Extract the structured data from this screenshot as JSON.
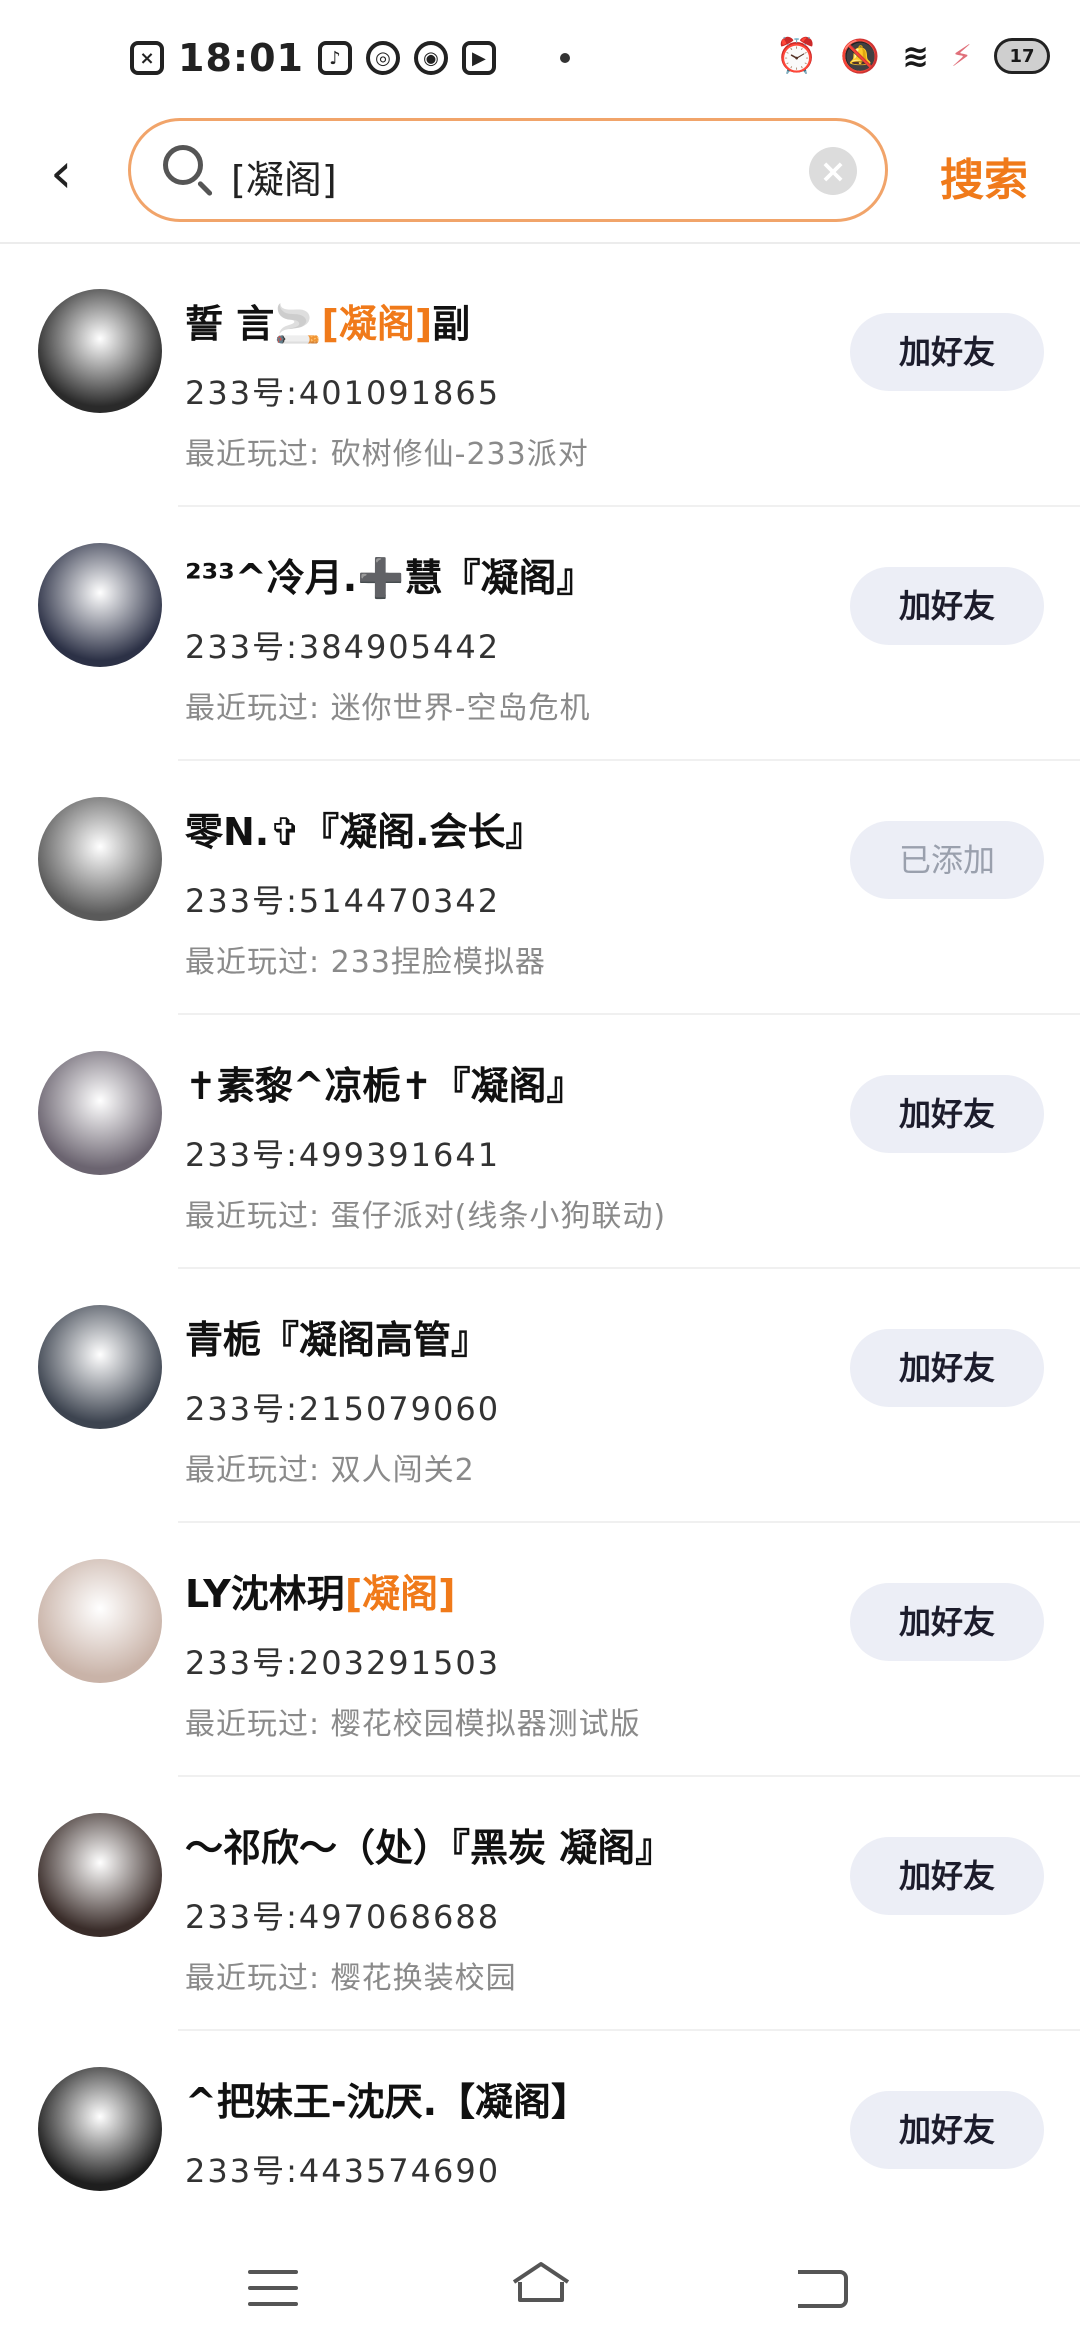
{
  "status_bar": {
    "time": "18:01",
    "battery": "17"
  },
  "search": {
    "query": "[凝阁]",
    "button_label": "搜索"
  },
  "users": [
    {
      "name_pre": "誓 言🚬",
      "name_hl": "[凝阁]",
      "name_post": "副",
      "uid": "233号:401091865",
      "recent": "最近玩过: 砍树修仙-233派对",
      "action": "加好友",
      "added": false,
      "avatar_color": "#2a2a2a"
    },
    {
      "name_pre": "²³³^冷月.➕慧『凝阁』",
      "name_hl": "",
      "name_post": "",
      "uid": "233号:384905442",
      "recent": "最近玩过: 迷你世界-空岛危机",
      "action": "加好友",
      "added": false,
      "avatar_color": "#2c3146"
    },
    {
      "name_pre": "零N.✞『凝阁.会长』",
      "name_hl": "",
      "name_post": "",
      "uid": "233号:514470342",
      "recent": "最近玩过: 233捏脸模拟器",
      "action": "已添加",
      "added": true,
      "avatar_color": "#5a5a5a"
    },
    {
      "name_pre": "✝素黎^凉栀✝『凝阁』",
      "name_hl": "",
      "name_post": "",
      "uid": "233号:499391641",
      "recent": "最近玩过: 蛋仔派对(线条小狗联动)",
      "action": "加好友",
      "added": false,
      "avatar_color": "#6b6470"
    },
    {
      "name_pre": "青栀『凝阁高管』",
      "name_hl": "",
      "name_post": "",
      "uid": "233号:215079060",
      "recent": "最近玩过: 双人闯关2",
      "action": "加好友",
      "added": false,
      "avatar_color": "#3d4450"
    },
    {
      "name_pre": "LY沈林玥",
      "name_hl": "[凝阁]",
      "name_post": "",
      "uid": "233号:203291503",
      "recent": "最近玩过: 樱花校园模拟器测试版",
      "action": "加好友",
      "added": false,
      "avatar_color": "#c9b3a8"
    },
    {
      "name_pre": "～祁欣～（处）『黑炭 凝阁』",
      "name_hl": "",
      "name_post": "",
      "uid": "233号:497068688",
      "recent": "最近玩过: 樱花换装校园",
      "action": "加好友",
      "added": false,
      "avatar_color": "#3a2d2a"
    },
    {
      "name_pre": "^把妹王-沈厌.【凝阁】",
      "name_hl": "",
      "name_post": "",
      "uid": "233号:443574690",
      "recent": "",
      "action": "加好友",
      "added": false,
      "avatar_color": "#1e1e1e"
    }
  ]
}
